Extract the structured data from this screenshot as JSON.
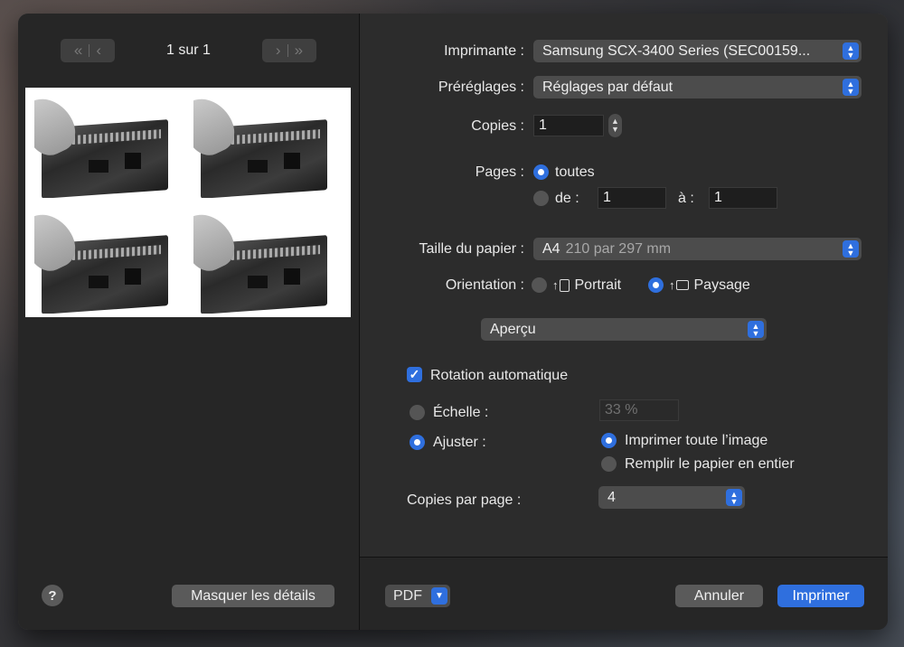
{
  "preview": {
    "page_indicator": "1 sur 1",
    "first_icon": "«",
    "prev_icon": "‹",
    "next_icon": "›",
    "last_icon": "»"
  },
  "left_footer": {
    "help_label": "?",
    "hide_details_label": "Masquer les détails"
  },
  "form": {
    "printer_label": "Imprimante :",
    "printer_value": "Samsung SCX-3400 Series (SEC00159...",
    "presets_label": "Préréglages :",
    "presets_value": "Réglages par défaut",
    "copies_label": "Copies :",
    "copies_value": "1",
    "pages_label": "Pages :",
    "pages_all_label": "toutes",
    "pages_from_label": "de :",
    "pages_from_value": "1",
    "pages_to_label": "à :",
    "pages_to_value": "1",
    "paper_size_label": "Taille du papier :",
    "paper_size_value": "A4",
    "paper_size_detail": "210 par 297 mm",
    "orientation_label": "Orientation :",
    "portrait_label": "Portrait",
    "landscape_label": "Paysage",
    "app_menu_value": "Aperçu",
    "auto_rotate_label": "Rotation automatique",
    "scale_label": "Échelle :",
    "scale_value": "33 %",
    "fit_label": "Ajuster :",
    "print_entire_label": "Imprimer toute l’image",
    "fill_paper_label": "Remplir le papier en entier",
    "copies_per_page_label": "Copies par page :",
    "copies_per_page_value": "4"
  },
  "footer": {
    "pdf_label": "PDF",
    "cancel_label": "Annuler",
    "print_label": "Imprimer"
  },
  "colors": {
    "accent": "#2f6fde",
    "dialog_bg": "#2c2c2c"
  }
}
